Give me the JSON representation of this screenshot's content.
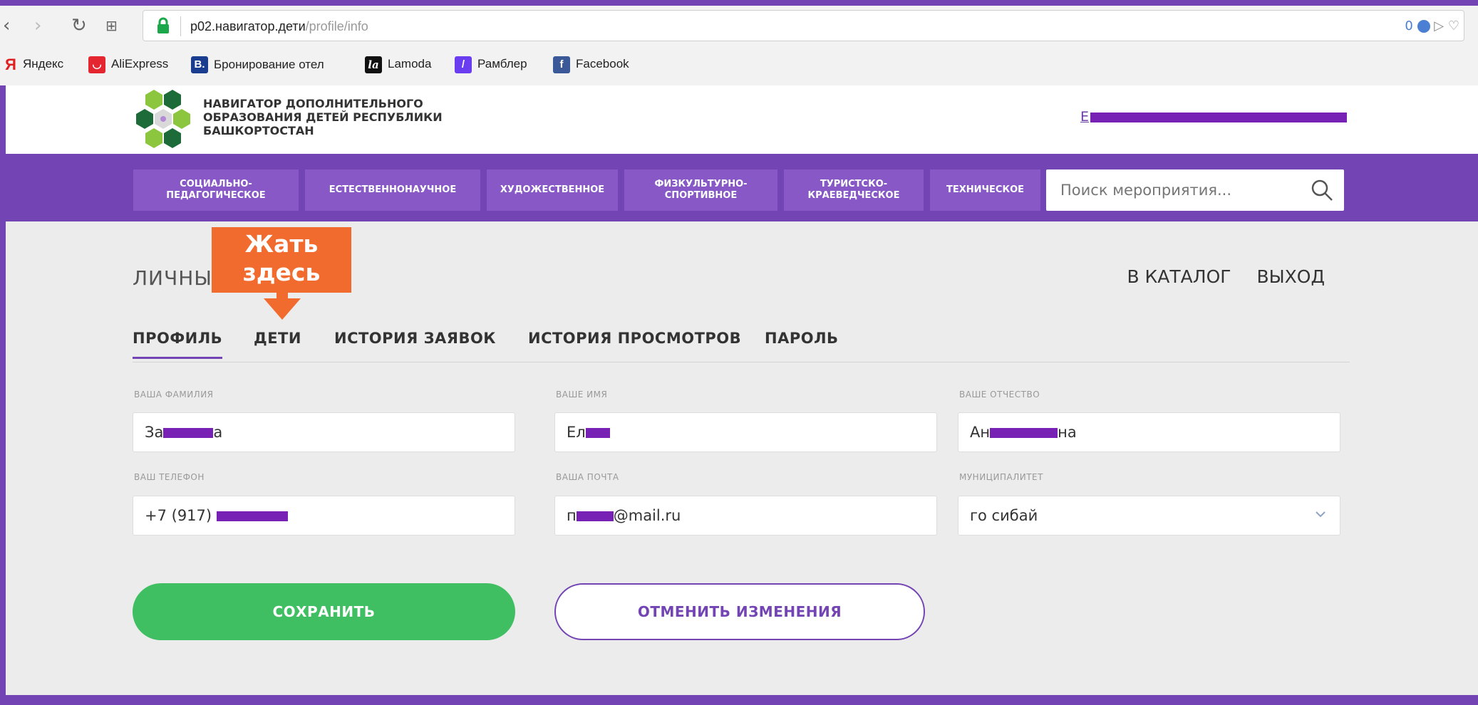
{
  "browser": {
    "address_host": "p02.навигатор.дети",
    "address_path": "/profile/info",
    "address_right": "0",
    "bookmarks": [
      {
        "label": "Яндекс",
        "icon": "yandex-icon"
      },
      {
        "label": "AliExpress",
        "icon": "aliexpress-icon"
      },
      {
        "label": "Бронирование отел",
        "icon": "booking-icon"
      },
      {
        "label": "Lamoda",
        "icon": "lamoda-icon"
      },
      {
        "label": "Рамблер",
        "icon": "rambler-icon"
      },
      {
        "label": "Facebook",
        "icon": "facebook-icon"
      }
    ]
  },
  "header": {
    "logo_line1": "НАВИГАТОР ДОПОЛНИТЕЛЬНОГО",
    "logo_line2": "ОБРАЗОВАНИЯ ДЕТЕЙ РЕСПУБЛИКИ",
    "logo_line3": "БАШКОРТОСТАН",
    "user_prefix": "Е"
  },
  "categories": [
    {
      "line1": "СОЦИАЛЬНО-",
      "line2": "ПЕДАГОГИЧЕСКОЕ"
    },
    {
      "line1": "ЕСТЕСТВЕННОНАУЧНОЕ",
      "line2": ""
    },
    {
      "line1": "ХУДОЖЕСТВЕННОЕ",
      "line2": ""
    },
    {
      "line1": "ФИЗКУЛЬТУРНО-",
      "line2": "СПОРТИВНОЕ"
    },
    {
      "line1": "ТУРИСТСКО-",
      "line2": "КРАЕВЕДЧЕСКОЕ"
    },
    {
      "line1": "ТЕХНИЧЕСКОЕ",
      "line2": ""
    }
  ],
  "search": {
    "placeholder": "Поиск мероприятия..."
  },
  "main": {
    "title": "ЛИЧНЫ",
    "catalog_link": "В КАТАЛОГ",
    "logout_link": "ВЫХОД",
    "callout_line1": "Жать",
    "callout_line2": "здесь",
    "tabs": [
      "ПРОФИЛЬ",
      "ДЕТИ",
      "ИСТОРИЯ ЗАЯВОК",
      "ИСТОРИЯ ПРОСМОТРОВ",
      "ПАРОЛЬ"
    ]
  },
  "form": {
    "lastname_label": "ВАША ФАМИЛИЯ",
    "lastname_start": "За",
    "lastname_end": "а",
    "firstname_label": "ВАШЕ ИМЯ",
    "firstname_start": "Ел",
    "middlename_label": "ВАШЕ ОТЧЕСТВО",
    "middlename_start": "Ан",
    "middlename_end": "на",
    "phone_label": "ВАШ ТЕЛЕФОН",
    "phone_start": "+7 (917) ",
    "email_label": "ВАША ПОЧТА",
    "email_start": "п",
    "email_end": "@mail.ru",
    "municipality_label": "МУНИЦИПАЛИТЕТ",
    "municipality_value": "го сибай",
    "save_label": "СОХРАНИТЬ",
    "cancel_label": "ОТМЕНИТЬ ИЗМЕНЕНИЯ"
  },
  "colors": {
    "brand_purple": "#7344b3",
    "save_green": "#3fbe62",
    "callout_orange": "#f26b2e",
    "redaction": "#7722b5"
  }
}
